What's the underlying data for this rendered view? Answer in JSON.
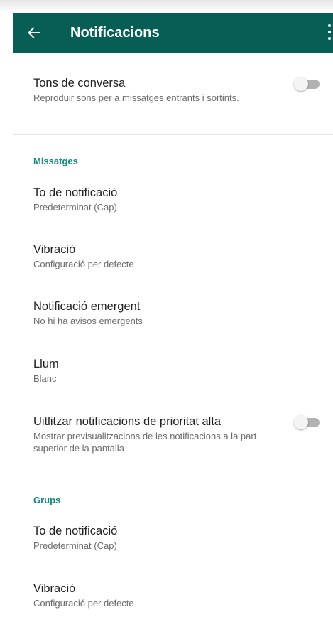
{
  "appbar": {
    "title": "Notificacions",
    "background": "#075e54",
    "back_icon": "arrow-left-icon",
    "more_icon": "more-vertical-icon"
  },
  "conversation_tones": {
    "title": "Tons de conversa",
    "subtitle": "Reproduir sons per a missatges entrants i sortints.",
    "toggle_on": false
  },
  "messages": {
    "header": "Missatges",
    "tone": {
      "title": "To de notificació",
      "subtitle": "Predeterminat (Cap)"
    },
    "vibration": {
      "title": "Vibració",
      "subtitle": "Configuració per defecte"
    },
    "popup": {
      "title": "Notificació emergent",
      "subtitle": "No hi ha avisos emergents"
    },
    "light": {
      "title": "Llum",
      "subtitle": "Blanc"
    },
    "high_priority": {
      "title": "Uitlitzar notificacions de prioritat alta",
      "subtitle": "Mostrar previsualitzacions de les notificacions a la part superior de la pantalla",
      "toggle_on": false
    }
  },
  "groups": {
    "header": "Grups",
    "tone": {
      "title": "To de notificació",
      "subtitle": "Predeterminat (Cap)"
    },
    "vibration": {
      "title": "Vibració",
      "subtitle": "Configuració per defecte"
    }
  },
  "colors": {
    "accent": "#128c7e",
    "toolbar": "#075e54"
  }
}
